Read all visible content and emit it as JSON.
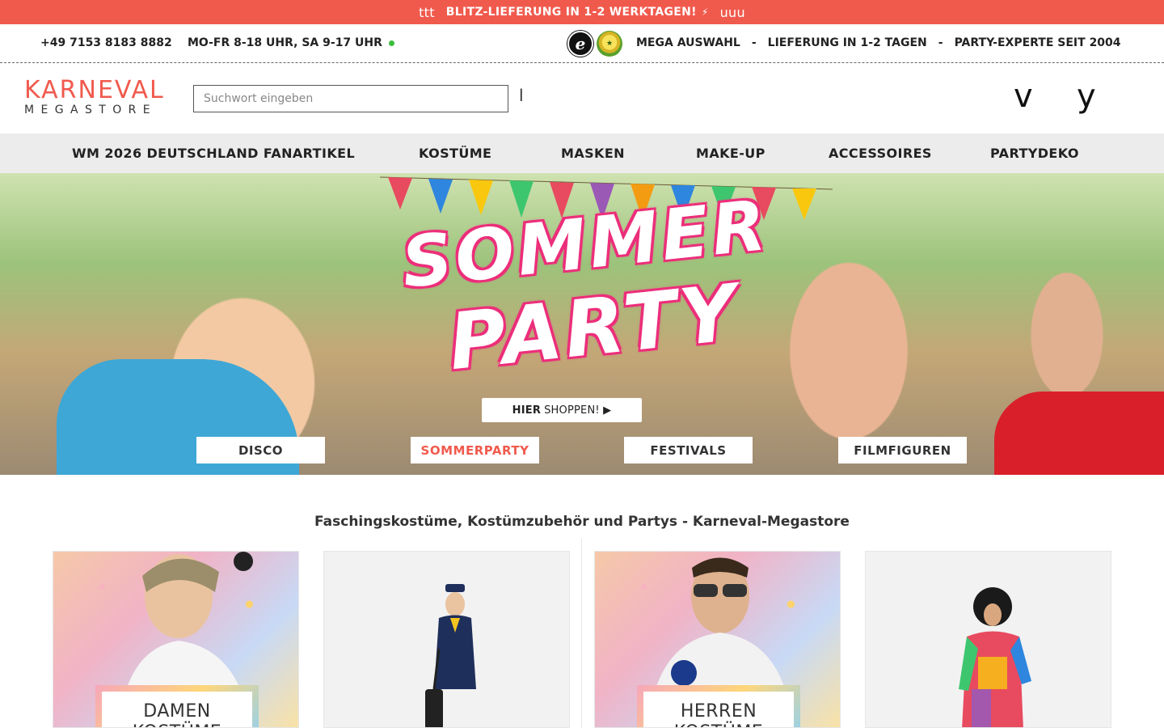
{
  "promo": {
    "left_deco": "ttt",
    "text": "BLITZ-LIEFERUNG IN 1-2 WERKTAGEN!",
    "bolt": "⚡",
    "right_deco": "uuu"
  },
  "infobar": {
    "phone": "+49 7153 8183 8882",
    "hours": "MO-FR 8-18 UHR, SA 9-17 UHR",
    "badge_e": "e",
    "usps": [
      "MEGA AUSWAHL",
      "-",
      "LIEFERUNG IN 1-2 TAGEN",
      "-",
      "PARTY-EXPERTE SEIT 2004"
    ]
  },
  "header": {
    "logo_line1": "KARNEVAL",
    "logo_line2": "MEGASTORE",
    "search_placeholder": "Suchwort eingeben",
    "search_icon_glyph": "l",
    "account_icon_glyph": "v",
    "cart_icon_glyph": "y"
  },
  "nav": [
    "WM 2026 DEUTSCHLAND FANARTIKEL",
    "KOSTÜME",
    "MASKEN",
    "MAKE-UP",
    "ACCESSOIRES",
    "PARTYDEKO"
  ],
  "hero": {
    "title_line1": "SOMMER",
    "title_line2": "PARTY",
    "shop_bold": "HIER",
    "shop_rest": "SHOPPEN! ▶",
    "categories": [
      "DISCO",
      "SOMMERPARTY",
      "FESTIVALS",
      "FILMFIGUREN"
    ],
    "accent_color": "#f05a4d"
  },
  "section_title": "Faschingskostüme, Kostümzubehör und Partys - Karneval-Megastore",
  "tiles": [
    {
      "label": "DAMEN KOSTÜME"
    },
    {
      "label": ""
    },
    {
      "label": "HERREN KOSTÜME"
    },
    {
      "label": ""
    }
  ]
}
